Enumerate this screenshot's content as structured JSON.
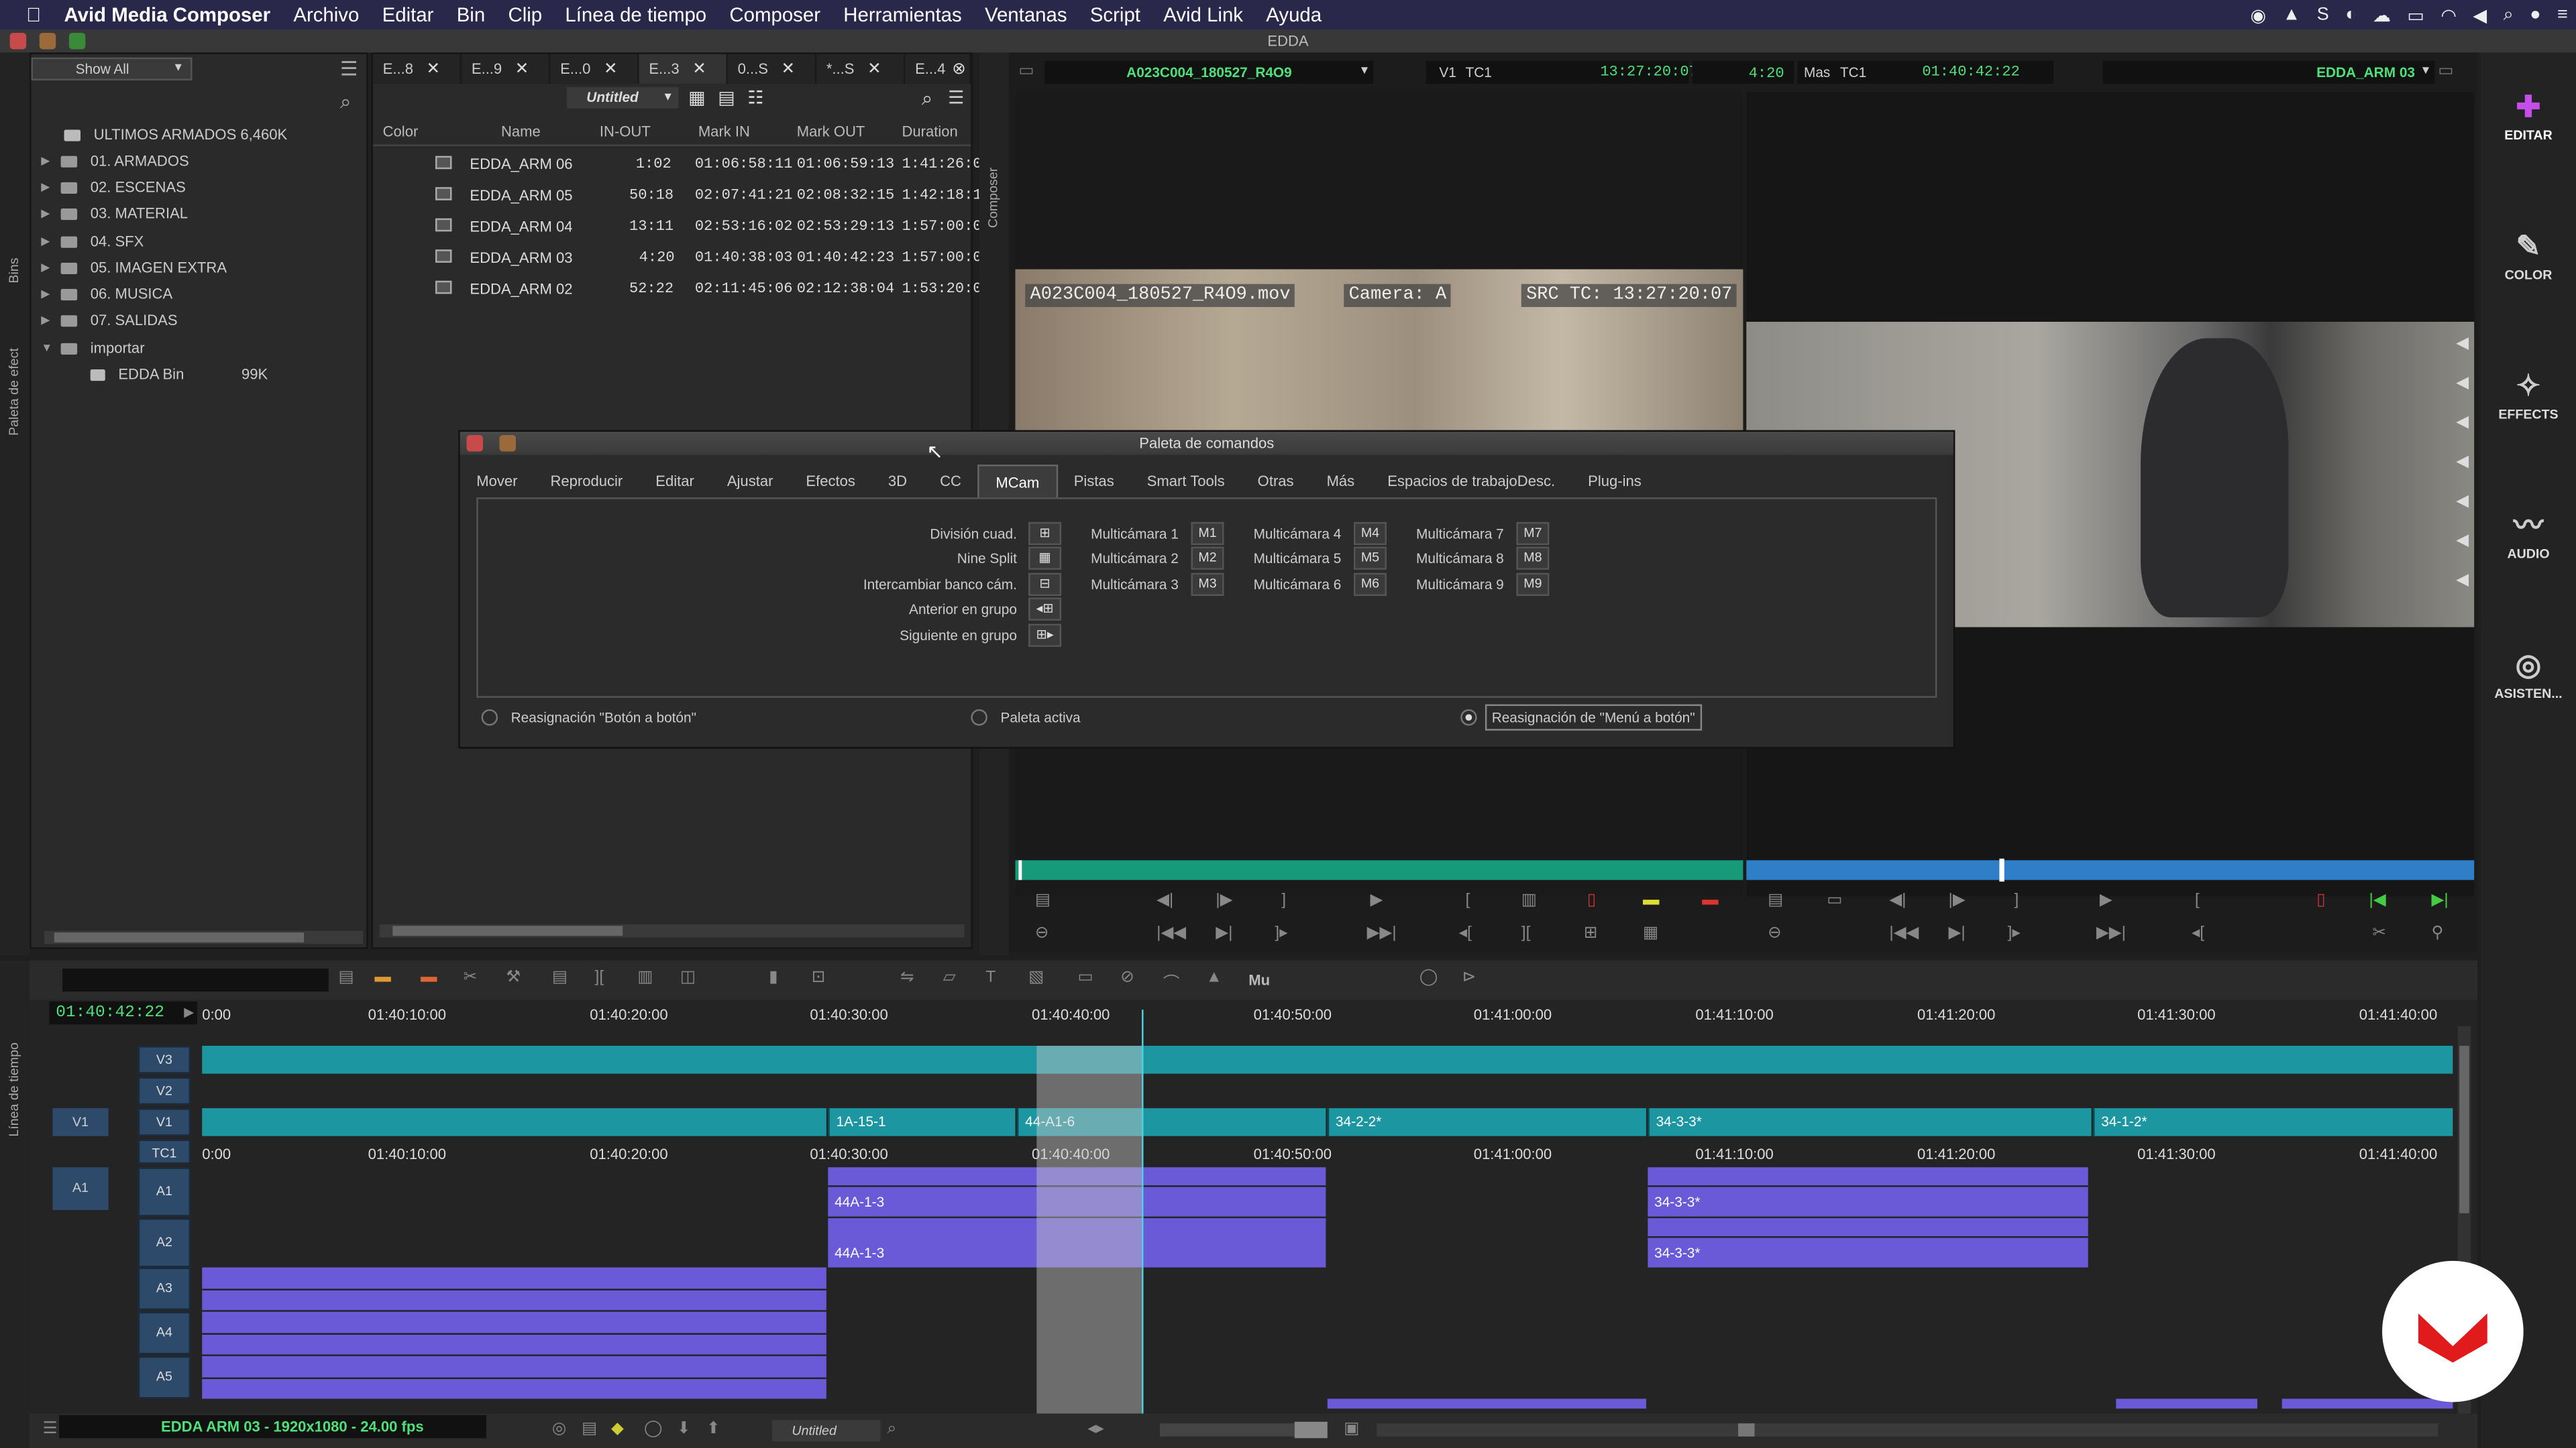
{
  "menubar": {
    "apple": "",
    "app": "Avid Media Composer",
    "items": [
      "Archivo",
      "Editar",
      "Bin",
      "Clip",
      "Línea de tiempo",
      "Composer",
      "Herramientas",
      "Ventanas",
      "Script",
      "Avid Link",
      "Ayuda"
    ]
  },
  "window": {
    "title": "EDDA"
  },
  "project": {
    "filter": "Show All",
    "side_tabs": {
      "bins": "Bins",
      "effects": "Paleta de efect"
    },
    "items": [
      {
        "label": "ULTIMOS ARMADOS  6,460K",
        "type": "bin"
      },
      {
        "label": "01. ARMADOS",
        "type": "folder"
      },
      {
        "label": "02. ESCENAS",
        "type": "folder"
      },
      {
        "label": "03. MATERIAL",
        "type": "folder"
      },
      {
        "label": "04. SFX",
        "type": "folder"
      },
      {
        "label": "05. IMAGEN EXTRA",
        "type": "folder"
      },
      {
        "label": "06. MUSICA",
        "type": "folder"
      },
      {
        "label": "07. SALIDAS",
        "type": "folder"
      },
      {
        "label": "importar",
        "type": "folder-open"
      },
      {
        "label": "EDDA Bin",
        "type": "bin",
        "size": "99K"
      }
    ]
  },
  "bin": {
    "tabs": [
      "E...8",
      "E...9",
      "E...0",
      "E...3",
      "0...S",
      "*...S",
      "E...4"
    ],
    "view_name": "Untitled",
    "columns": {
      "color": "Color",
      "name": "Name",
      "inout": "IN-OUT",
      "markin": "Mark IN",
      "markout": "Mark OUT",
      "duration": "Duration"
    },
    "rows": [
      {
        "name": "EDDA_ARM 06",
        "inout": "1:02",
        "markin": "01:06:58:11",
        "markout": "01:06:59:13",
        "duration": "1:41:26:0"
      },
      {
        "name": "EDDA_ARM 05",
        "inout": "50:18",
        "markin": "02:07:41:21",
        "markout": "02:08:32:15",
        "duration": "1:42:18:1"
      },
      {
        "name": "EDDA_ARM 04",
        "inout": "13:11",
        "markin": "02:53:16:02",
        "markout": "02:53:29:13",
        "duration": "1:57:00:0"
      },
      {
        "name": "EDDA_ARM 03",
        "inout": "4:20",
        "markin": "01:40:38:03",
        "markout": "01:40:42:23",
        "duration": "1:57:00:0"
      },
      {
        "name": "EDDA_ARM 02",
        "inout": "52:22",
        "markin": "02:11:45:06",
        "markout": "02:12:38:04",
        "duration": "1:53:20:0"
      }
    ]
  },
  "composer": {
    "side_tab": "Composer",
    "source_clip": "A023C004_180527_R4O9",
    "src_track": "V1",
    "src_tc_label": "TC1",
    "src_tc": "13:27:20:07",
    "duration": "4:20",
    "mas_label": "Mas",
    "mas_tc_label": "TC1",
    "mas_tc": "01:40:42:22",
    "record_seq": "EDDA_ARM 03",
    "overlay": {
      "file": "A023C004_180527_R4O9.mov",
      "camera": "Camera: A",
      "src_tc": "SRC TC: 13:27:20:07"
    }
  },
  "palette": {
    "title": "Paleta de comandos",
    "tabs": [
      "Mover",
      "Reproducir",
      "Editar",
      "Ajustar",
      "Efectos",
      "3D",
      "CC",
      "MCam",
      "Pistas",
      "Smart Tools",
      "Otras",
      "Más",
      "Espacios de trabajoDesc.",
      "Plug-ins"
    ],
    "active_tab": "MCam",
    "commands_left": [
      "División cuad.",
      "Nine Split",
      "Intercambiar banco cám.",
      "Anterior en grupo",
      "Siguiente en grupo"
    ],
    "multicam": [
      [
        {
          "label": "Multicámara 1",
          "btn": "M1"
        },
        {
          "label": "Multicámara 2",
          "btn": "M2"
        },
        {
          "label": "Multicámara 3",
          "btn": "M3"
        }
      ],
      [
        {
          "label": "Multicámara 4",
          "btn": "M4"
        },
        {
          "label": "Multicámara 5",
          "btn": "M5"
        },
        {
          "label": "Multicámara 6",
          "btn": "M6"
        }
      ],
      [
        {
          "label": "Multicámara 7",
          "btn": "M7"
        },
        {
          "label": "Multicámara 8",
          "btn": "M8"
        },
        {
          "label": "Multicámara 9",
          "btn": "M9"
        }
      ]
    ],
    "radios": [
      {
        "label": "Reasignación \"Botón a botón\"",
        "selected": false
      },
      {
        "label": "Paleta activa",
        "selected": false
      },
      {
        "label": "Reasignación de \"Menú a botón\"",
        "selected": true
      }
    ]
  },
  "workspaces": [
    {
      "label": "EDITAR",
      "icon": "edit-icon"
    },
    {
      "label": "COLOR",
      "icon": "color-icon"
    },
    {
      "label": "EFFECTS",
      "icon": "effects-icon"
    },
    {
      "label": "AUDIO",
      "icon": "audio-icon"
    },
    {
      "label": "ASISTEN...",
      "icon": "assist-icon"
    }
  ],
  "timeline": {
    "side_tab": "Línea de tiempo",
    "current_tc": "01:40:42:22",
    "mu_label": "Mu",
    "ruler": [
      "0:00",
      "01:40:10:00",
      "01:40:20:00",
      "01:40:30:00",
      "01:40:40:00",
      "01:40:50:00",
      "01:41:00:00",
      "01:41:10:00",
      "01:41:20:00",
      "01:41:30:00",
      "01:41:40:00"
    ],
    "tracks": [
      "V3",
      "V2",
      "V1",
      "TC1",
      "A1",
      "A2",
      "A3",
      "A4",
      "A5"
    ],
    "src_tracks": {
      "v1": "V1",
      "a1": "A1"
    },
    "v1_clips": [
      "1A-15-1",
      "44-A1-6",
      "34-2-2*",
      "34-3-3*",
      "34-1-2*"
    ],
    "a_clips": [
      "44A-1-3",
      "34-3-3*",
      "44A-1-3",
      "34-3-3*"
    ],
    "status": "EDDA ARM 03 - 1920x1080 - 24.00 fps",
    "view_name": "Untitled"
  },
  "colors": {
    "accent": "#4fe07a",
    "video_clip": "#1c97a2",
    "audio_clip": "#6a5ad8",
    "record_bar": "#2f7fc8",
    "source_bar": "#179a7a"
  }
}
